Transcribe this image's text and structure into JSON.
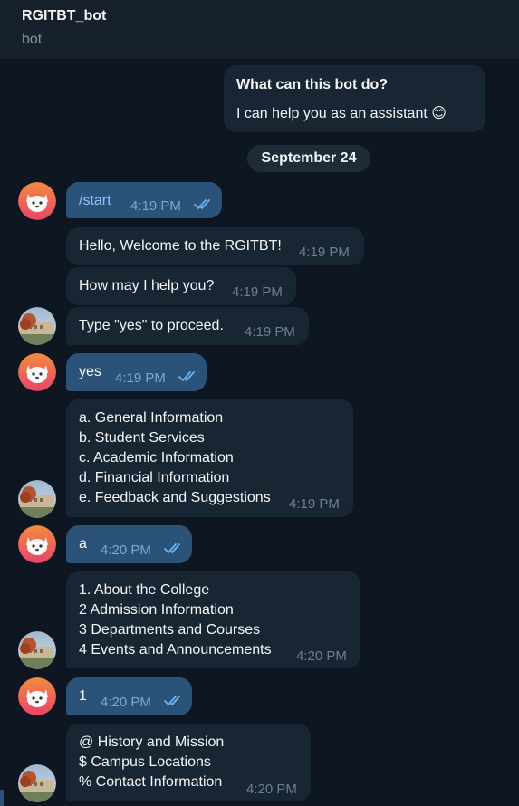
{
  "header": {
    "title": "RGITBT_bot",
    "subtitle": "bot"
  },
  "intro": {
    "title": "What can this bot do?",
    "text": "I can help you as an assistant",
    "emoji": "😊"
  },
  "date_separator": "September 24",
  "messages": [
    {
      "dir": "out",
      "text": "/start",
      "time": "4:19 PM"
    },
    {
      "dir": "in",
      "text": "Hello, Welcome to the RGITBT!",
      "time": "4:19 PM"
    },
    {
      "dir": "in",
      "text": "How may I help you?",
      "time": "4:19 PM"
    },
    {
      "dir": "in",
      "text": "Type \"yes\" to proceed.",
      "time": "4:19 PM"
    },
    {
      "dir": "out",
      "text": "yes",
      "time": "4:19 PM"
    },
    {
      "dir": "in",
      "lines": [
        "a. General Information",
        "b. Student Services",
        "c. Academic Information",
        "d. Financial Information",
        "e. Feedback and Suggestions"
      ],
      "time": "4:19 PM"
    },
    {
      "dir": "out",
      "text": "a",
      "time": "4:20 PM"
    },
    {
      "dir": "in",
      "lines": [
        "1. About the College",
        "2 Admission Information",
        "3 Departments and Courses",
        "4 Events and Announcements"
      ],
      "time": "4:20 PM"
    },
    {
      "dir": "out",
      "text": "1",
      "time": "4:20 PM"
    },
    {
      "dir": "in",
      "lines": [
        "@ History and Mission",
        "$ Campus Locations",
        "% Contact Information"
      ],
      "time": "4:20 PM"
    }
  ],
  "colors": {
    "background": "#0e1621",
    "incoming": "#182533",
    "outgoing": "#2b5278",
    "header": "#17212b",
    "read_ticks": "#6ab3f3"
  }
}
